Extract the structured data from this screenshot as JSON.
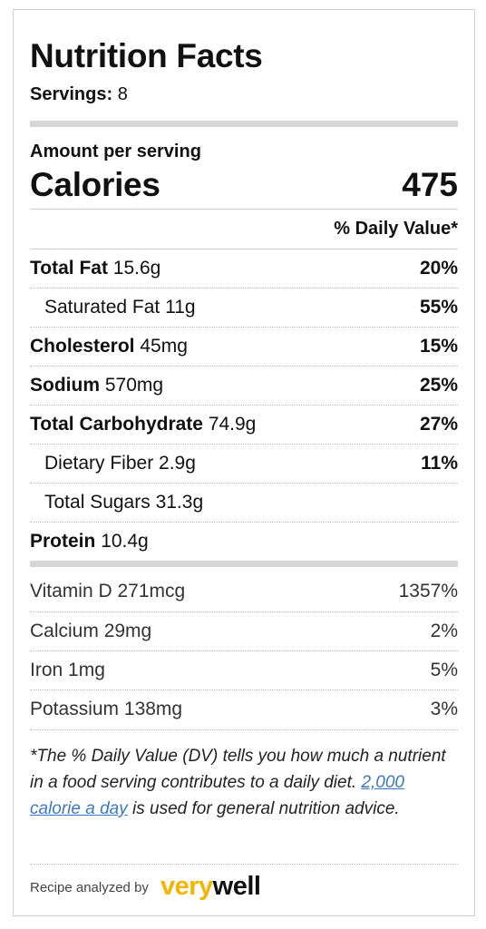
{
  "header": {
    "title": "Nutrition Facts",
    "servings_label": "Servings:",
    "servings_value": "8"
  },
  "calories": {
    "amount_per_serving": "Amount per serving",
    "label": "Calories",
    "value": "475"
  },
  "daily_value_header": "% Daily Value*",
  "nutrients": [
    {
      "label": "Total Fat",
      "amount": "15.6g",
      "dv": "20%"
    },
    {
      "label": "Saturated Fat",
      "amount": "11g",
      "dv": "55%"
    },
    {
      "label": "Cholesterol",
      "amount": "45mg",
      "dv": "15%"
    },
    {
      "label": "Sodium",
      "amount": "570mg",
      "dv": "25%"
    },
    {
      "label": "Total Carbohydrate",
      "amount": "74.9g",
      "dv": "27%"
    },
    {
      "label": "Dietary Fiber",
      "amount": "2.9g",
      "dv": "11%"
    },
    {
      "label": "Total Sugars",
      "amount": "31.3g",
      "dv": ""
    },
    {
      "label": "Protein",
      "amount": "10.4g",
      "dv": ""
    }
  ],
  "vitamins": [
    {
      "label": "Vitamin D",
      "amount": "271mcg",
      "dv": "1357%"
    },
    {
      "label": "Calcium",
      "amount": "29mg",
      "dv": "2%"
    },
    {
      "label": "Iron",
      "amount": "1mg",
      "dv": "5%"
    },
    {
      "label": "Potassium",
      "amount": "138mg",
      "dv": "3%"
    }
  ],
  "footnote": {
    "before_link": "*The % Daily Value (DV) tells you how much a nutrient in a food serving contributes to a daily diet. ",
    "link_text": "2,000 calorie a day",
    "after_link": " is used for general nutrition advice."
  },
  "attribution": {
    "prefix": "Recipe analyzed by",
    "logo_part1": "very",
    "logo_part2": "well"
  }
}
